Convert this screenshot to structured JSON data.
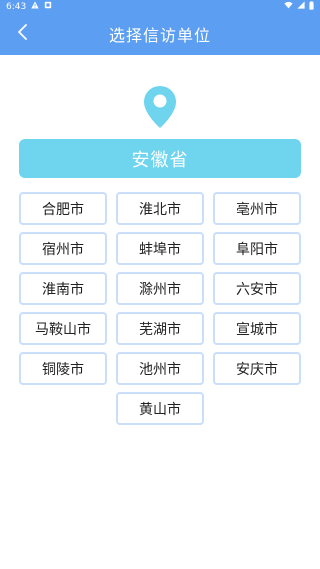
{
  "status_bar": {
    "time": "6:43",
    "icons": [
      "warning-icon",
      "notification-icon",
      "wifi-icon",
      "signal-icon",
      "battery-icon"
    ]
  },
  "app_bar": {
    "title": "选择信访单位",
    "back_icon": "chevron-left-icon"
  },
  "colors": {
    "header": "#5b9ef2",
    "province_button": "#6fd4ee",
    "pin": "#6fd4ee",
    "city_border": "#c9def8"
  },
  "province": {
    "label": "安徽省"
  },
  "cities": [
    {
      "label": "合肥市"
    },
    {
      "label": "淮北市"
    },
    {
      "label": "亳州市"
    },
    {
      "label": "宿州市"
    },
    {
      "label": "蚌埠市"
    },
    {
      "label": "阜阳市"
    },
    {
      "label": "淮南市"
    },
    {
      "label": "滁州市"
    },
    {
      "label": "六安市"
    },
    {
      "label": "马鞍山市"
    },
    {
      "label": "芜湖市"
    },
    {
      "label": "宣城市"
    },
    {
      "label": "铜陵市"
    },
    {
      "label": "池州市"
    },
    {
      "label": "安庆市"
    },
    {
      "label": "黄山市"
    }
  ]
}
